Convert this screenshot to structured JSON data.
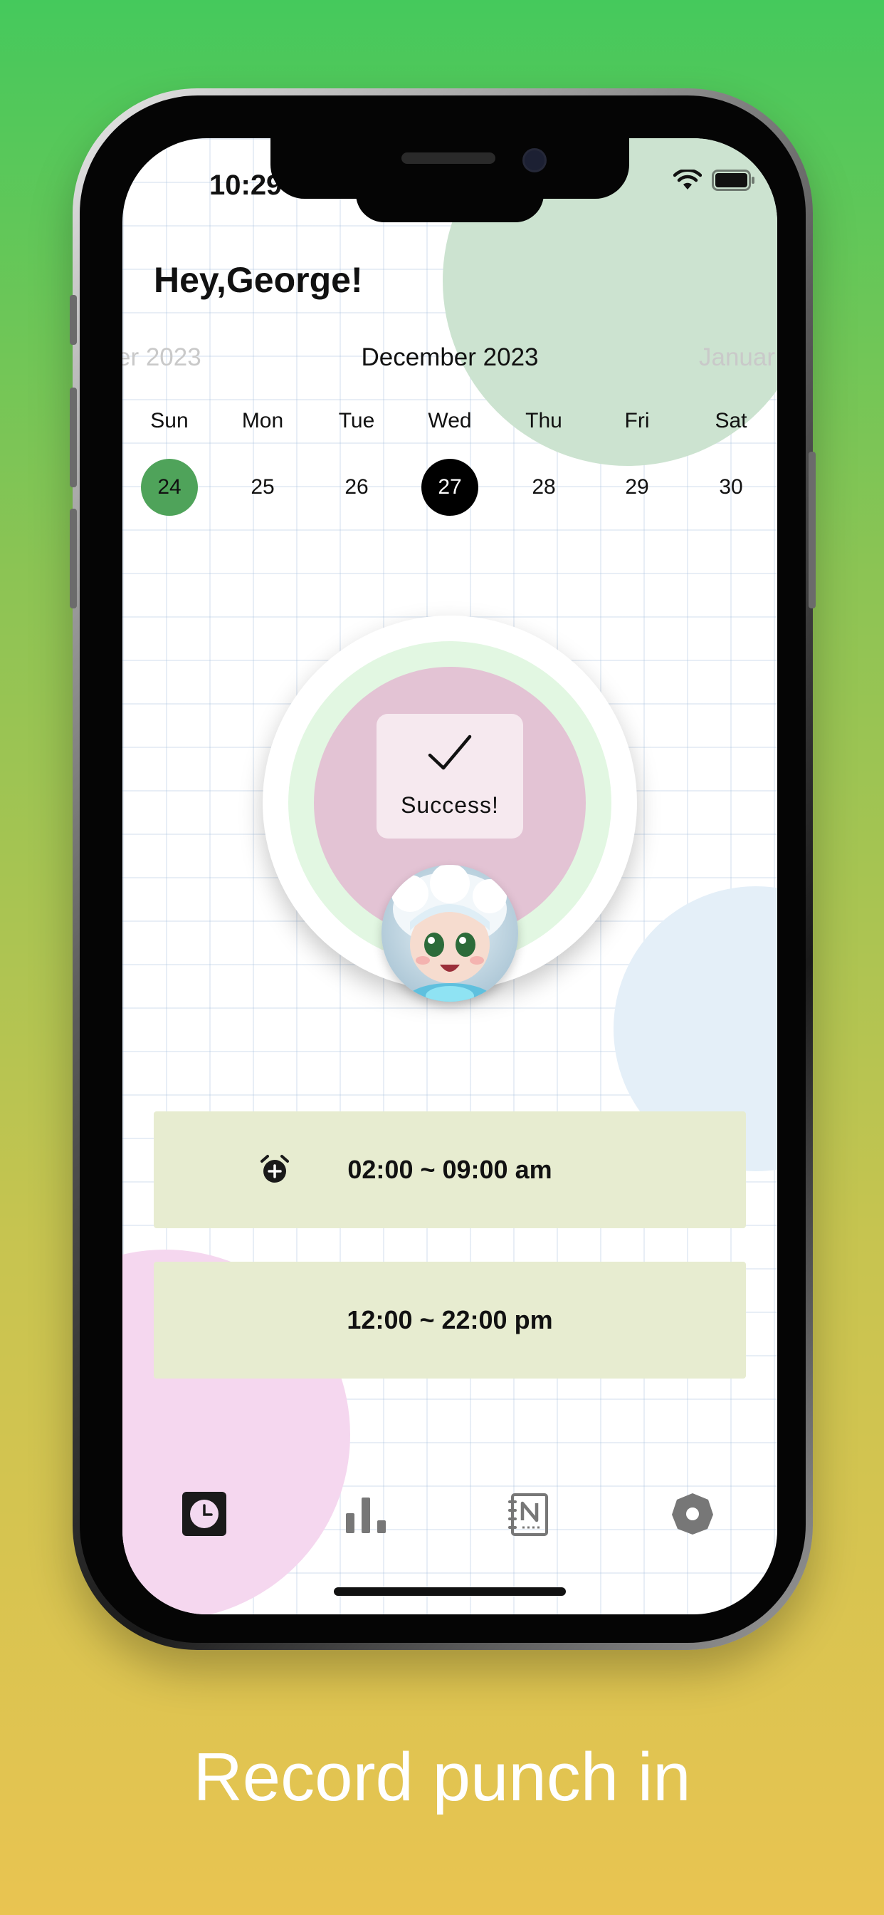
{
  "status_bar": {
    "time": "10:29"
  },
  "header": {
    "greeting": "Hey,George!"
  },
  "calendar": {
    "prev_month": "er 2023",
    "current_month": "December 2023",
    "next_month": "Januar",
    "days": [
      {
        "name": "Sun",
        "number": "24",
        "state": "completed"
      },
      {
        "name": "Mon",
        "number": "25",
        "state": "normal"
      },
      {
        "name": "Tue",
        "number": "26",
        "state": "normal"
      },
      {
        "name": "Wed",
        "number": "27",
        "state": "today"
      },
      {
        "name": "Thu",
        "number": "28",
        "state": "normal"
      },
      {
        "name": "Fri",
        "number": "29",
        "state": "normal"
      },
      {
        "name": "Sat",
        "number": "30",
        "state": "normal"
      }
    ]
  },
  "punch": {
    "toast_text": "Success!",
    "toast_icon": "checkmark-icon",
    "avatar": "character-avatar"
  },
  "slots": [
    {
      "time": "02:00 ~ 09:00 am",
      "icon": "alarm-add-icon"
    },
    {
      "time": "12:00 ~ 22:00 pm"
    }
  ],
  "tabs": [
    {
      "name": "clock-tab",
      "icon": "clock-icon",
      "active": true
    },
    {
      "name": "stats-tab",
      "icon": "bar-chart-icon",
      "active": false
    },
    {
      "name": "notes-tab",
      "icon": "notebook-icon",
      "active": false
    },
    {
      "name": "settings-tab",
      "icon": "settings-icon",
      "active": false
    }
  ],
  "caption": "Record punch in",
  "colors": {
    "completed_day": "#4fa35a",
    "today_day": "#000000",
    "slot_bg": "#e7ecd0",
    "ring_inner": "#e3c3d4",
    "ring_mid": "#e2f7e2"
  }
}
